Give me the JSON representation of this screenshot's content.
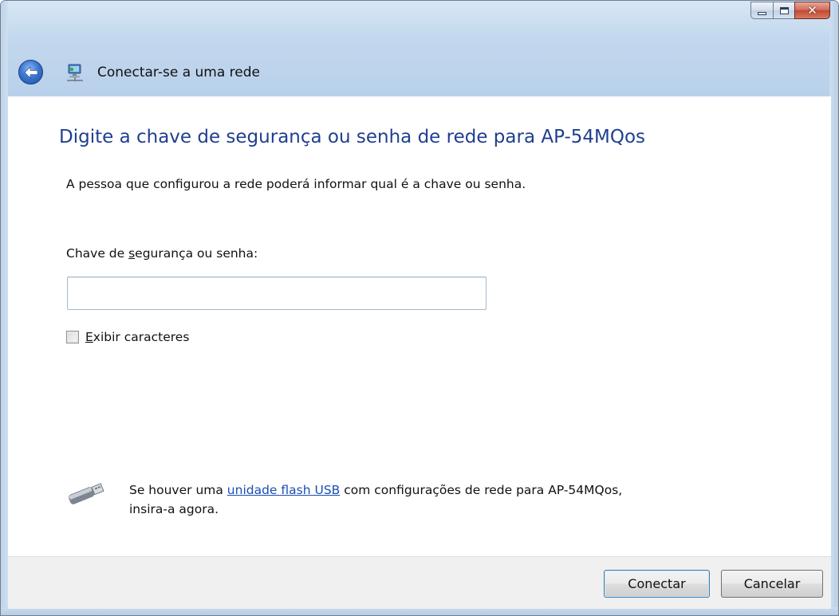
{
  "window": {
    "title": "Conectar-se a uma rede",
    "caption_buttons": {
      "minimize_icon": "minimize-icon",
      "maximize_icon": "maximize-icon",
      "close_icon": "close-icon"
    },
    "back_icon": "back-arrow-icon",
    "title_icon": "network-icon"
  },
  "content": {
    "main_instruction": "Digite a chave de segurança ou senha de rede para AP-54MQos",
    "description": "A pessoa que configurou a rede poderá informar qual é a chave ou senha.",
    "field_label_pre": "Chave de ",
    "field_label_accel": "s",
    "field_label_post": "egurança ou senha:",
    "key_input_value": "",
    "show_chars_accel": "E",
    "show_chars_rest": "xibir caracteres",
    "show_chars_checked": false,
    "usb_icon": "usb-drive-icon",
    "usb_text_pre": "Se houver uma ",
    "usb_link": "unidade flash USB",
    "usb_text_post": " com configurações de rede para AP-54MQos,",
    "usb_text_line2": "insira-a agora."
  },
  "buttons": {
    "connect": "Conectar",
    "cancel": "Cancelar"
  },
  "colors": {
    "instruction": "#1f3f8f",
    "link": "#1a4fb3",
    "close_button": "#c04a33"
  }
}
